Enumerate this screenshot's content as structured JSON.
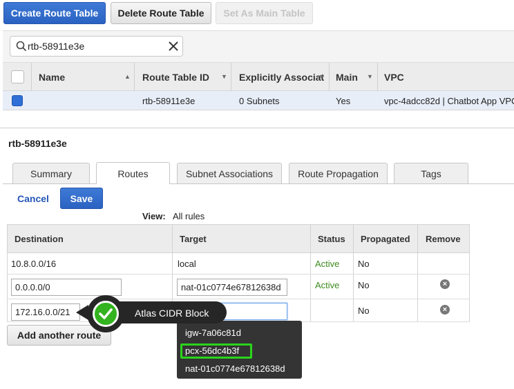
{
  "toolbar": {
    "create_label": "Create Route Table",
    "delete_label": "Delete Route Table",
    "set_main_label": "Set As Main Table"
  },
  "search": {
    "value": "rtb-58911e3e"
  },
  "table": {
    "columns": [
      "Name",
      "Route Table ID",
      "Explicitly Associat",
      "Main",
      "VPC"
    ],
    "row": {
      "name": "",
      "route_table_id": "rtb-58911e3e",
      "explicitly_associated": "0 Subnets",
      "main": "Yes",
      "vpc": "vpc-4adcc82d | Chatbot App VPC"
    }
  },
  "detail": {
    "title": "rtb-58911e3e",
    "tabs": [
      "Summary",
      "Routes",
      "Subnet Associations",
      "Route Propagation",
      "Tags"
    ],
    "active_tab": "Routes",
    "cancel_label": "Cancel",
    "save_label": "Save",
    "view_label": "View:",
    "view_value": "All rules"
  },
  "routes": {
    "columns": [
      "Destination",
      "Target",
      "Status",
      "Propagated",
      "Remove"
    ],
    "rows": [
      {
        "destination": "10.8.0.0/16",
        "target": "local",
        "status": "Active",
        "propagated": "No"
      },
      {
        "destination": "0.0.0.0/0",
        "target": "nat-01c0774e67812638d",
        "status": "Active",
        "propagated": "No"
      },
      {
        "destination": "172.16.0.0/21",
        "target": "",
        "status": "",
        "propagated": "No"
      }
    ],
    "add_label": "Add another route"
  },
  "dropdown": {
    "options": [
      "igw-7a06c81d",
      "pcx-56dc4b3f",
      "nat-01c0774e67812638d"
    ],
    "highlighted": "pcx-56dc4b3f"
  },
  "callout": {
    "text": "Atlas CIDR Block"
  },
  "colors": {
    "primary": "#2a62c2",
    "active_status": "#3d8a1e",
    "highlight": "#2bd41c",
    "callout_bg": "#262626"
  }
}
